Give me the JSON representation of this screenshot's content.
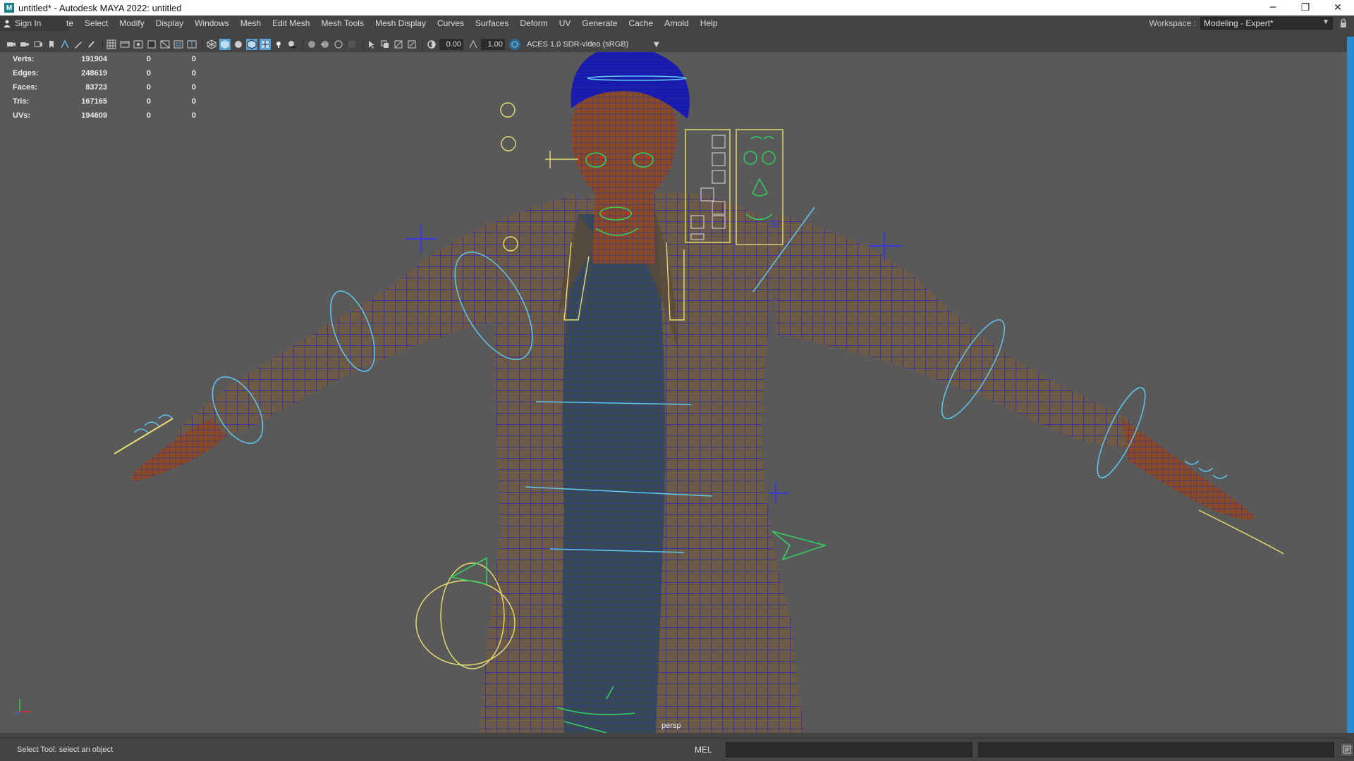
{
  "window": {
    "title": "untitled* - Autodesk MAYA 2022: untitled",
    "app_icon": "M",
    "minimize": "─",
    "restore": "❐",
    "close": "✕"
  },
  "menubar": {
    "signin": "Sign In",
    "partial_item": "te",
    "items": [
      "Select",
      "Modify",
      "Display",
      "Windows",
      "Mesh",
      "Edit Mesh",
      "Mesh Tools",
      "Mesh Display",
      "Curves",
      "Surfaces",
      "Deform",
      "UV",
      "Generate",
      "Cache",
      "Arnold",
      "Help"
    ],
    "workspace_label": "Workspace :",
    "workspace_value": "Modeling - Expert*"
  },
  "viewport_toolbar": {
    "exposure": "0.00",
    "gamma": "1.00",
    "color_space": "ACES 1.0 SDR-video (sRGB)"
  },
  "hud_stats": [
    {
      "label": "Verts:",
      "v1": "191904",
      "v2": "0",
      "v3": "0"
    },
    {
      "label": "Edges:",
      "v1": "248619",
      "v2": "0",
      "v3": "0"
    },
    {
      "label": "Faces:",
      "v1": "83723",
      "v2": "0",
      "v3": "0"
    },
    {
      "label": "Tris:",
      "v1": "167165",
      "v2": "0",
      "v3": "0"
    },
    {
      "label": "UVs:",
      "v1": "194609",
      "v2": "0",
      "v3": "0"
    }
  ],
  "camera": "persp",
  "helpline": {
    "text": "Select Tool: select an object",
    "mel_label": "MEL"
  },
  "colors": {
    "viewport_bg": "#595959",
    "wireframe": "#1e1ec8",
    "controls_cyan": "#5ec8f0",
    "controls_yellow": "#e8e070",
    "controls_green": "#30d060",
    "accent_blue": "#1f8fcf"
  }
}
